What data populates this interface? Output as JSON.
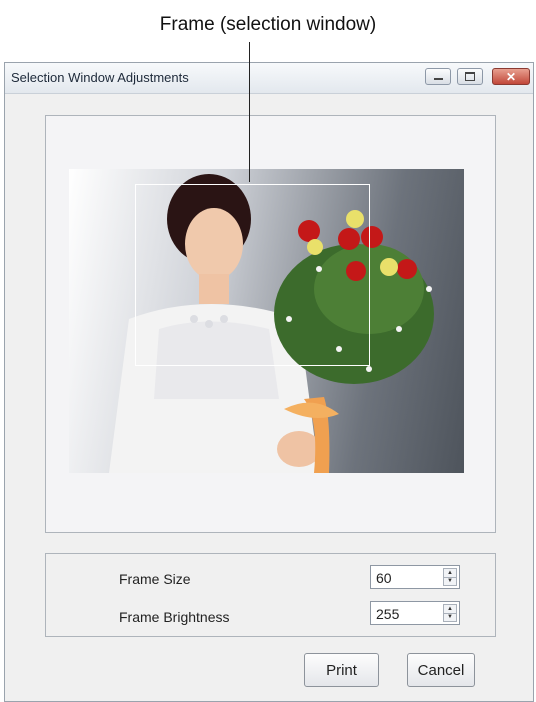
{
  "annotation": {
    "frame_label": "Frame (selection window)"
  },
  "window": {
    "title": "Selection Window Adjustments",
    "controls": {
      "minimize": "minimize-icon",
      "maximize": "maximize-icon",
      "close": "close-icon"
    }
  },
  "settings": {
    "frame_size_label": "Frame Size",
    "frame_size_value": "60",
    "frame_brightness_label": "Frame Brightness",
    "frame_brightness_value": "255"
  },
  "buttons": {
    "print": "Print",
    "cancel": "Cancel"
  },
  "close_glyph": "✕"
}
